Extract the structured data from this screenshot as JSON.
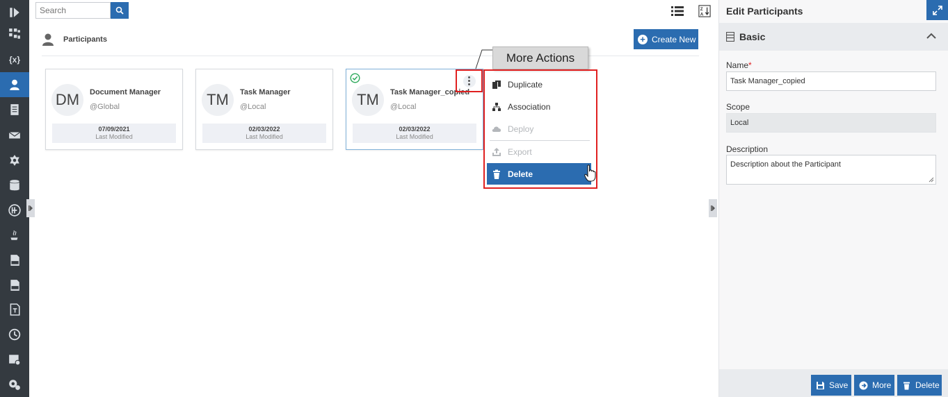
{
  "search": {
    "placeholder": "Search"
  },
  "section": {
    "title": "Participants",
    "create_label": "Create New"
  },
  "cards": [
    {
      "initials": "DM",
      "name": "Document Manager",
      "scope": "@Global",
      "date": "07/09/2021",
      "date_label": "Last Modified"
    },
    {
      "initials": "TM",
      "name": "Task Manager",
      "scope": "@Local",
      "date": "02/03/2022",
      "date_label": "Last Modified"
    },
    {
      "initials": "TM",
      "name": "Task Manager_copied",
      "scope": "@Local",
      "date": "02/03/2022",
      "date_label": "Last Modified"
    }
  ],
  "callout": "More Actions",
  "menu": {
    "items": [
      {
        "label": "Duplicate",
        "icon": "duplicate-icon",
        "disabled": false
      },
      {
        "label": "Association",
        "icon": "association-icon",
        "disabled": false
      },
      {
        "label": "Deploy",
        "icon": "deploy-icon",
        "disabled": true
      },
      {
        "label": "Export",
        "icon": "export-icon",
        "disabled": true
      },
      {
        "label": "Delete",
        "icon": "trash-icon",
        "disabled": false
      }
    ]
  },
  "nav": {
    "items": [
      {
        "icon": "collapse-icon"
      },
      {
        "icon": "process-icon"
      },
      {
        "icon": "variables-icon",
        "text": "{x}"
      },
      {
        "icon": "participants-icon",
        "active": true
      },
      {
        "icon": "document-icon"
      },
      {
        "icon": "mail-icon"
      },
      {
        "icon": "gear-icon"
      },
      {
        "icon": "database-icon"
      },
      {
        "icon": "dt-icon"
      },
      {
        "icon": "java-icon"
      },
      {
        "icon": "file-icon"
      },
      {
        "icon": "css-icon"
      },
      {
        "icon": "text-icon"
      },
      {
        "icon": "clock-icon"
      },
      {
        "icon": "schedule-icon"
      },
      {
        "icon": "settings-icon"
      }
    ]
  },
  "panel": {
    "title": "Edit Participants",
    "section": "Basic",
    "name_label": "Name",
    "name_required": "*",
    "name_value": "Task Manager_copied",
    "scope_label": "Scope",
    "scope_value": "Local",
    "description_label": "Description",
    "description_value": "Description about the Participant",
    "buttons": {
      "save": "Save",
      "more": "More",
      "delete": "Delete"
    }
  },
  "colors": {
    "accent": "#2b6cb0",
    "nav_bg": "#343a40",
    "highlight": "#e02020",
    "success": "#2eaa5c"
  }
}
